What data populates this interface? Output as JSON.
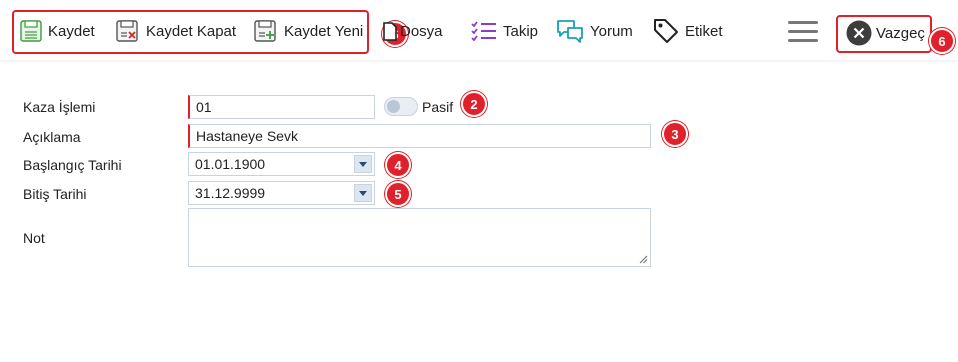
{
  "toolbar": {
    "kaydet": "Kaydet",
    "kaydet_kapat": "Kaydet Kapat",
    "kaydet_yeni": "Kaydet Yeni",
    "dosya": "Dosya",
    "takip": "Takip",
    "yorum": "Yorum",
    "etiket": "Etiket",
    "vazgec": "Vazgeç"
  },
  "form": {
    "kaza_islemi_label": "Kaza İşlemi",
    "kaza_islemi_value": "01",
    "pasif_label": "Pasif",
    "aciklama_label": "Açıklama",
    "aciklama_value": "Hastaneye Sevk",
    "baslangic_label": "Başlangıç Tarihi",
    "baslangic_value": "01.01.1900",
    "bitis_label": "Bitiş Tarihi",
    "bitis_value": "31.12.9999",
    "not_label": "Not",
    "not_value": ""
  },
  "annotations": {
    "badge_toolbar": "6",
    "badge_pasif": "2",
    "badge_aciklama": "3",
    "badge_baslangic": "4",
    "badge_bitis": "5",
    "badge_vazgec": "6"
  },
  "colors": {
    "accent_red": "#e0202a",
    "save_green": "#3f9b3f",
    "purple": "#8a3ccf",
    "teal": "#1a9fb5"
  },
  "icons": {
    "kaydet": "floppy-icon",
    "kaydet_kapat": "floppy-close-icon",
    "kaydet_yeni": "floppy-plus-icon",
    "dosya": "file-icon",
    "takip": "checklist-icon",
    "yorum": "chat-bubbles-icon",
    "etiket": "tag-icon",
    "vazgec": "close-circle-icon",
    "menu": "hamburger-icon"
  }
}
